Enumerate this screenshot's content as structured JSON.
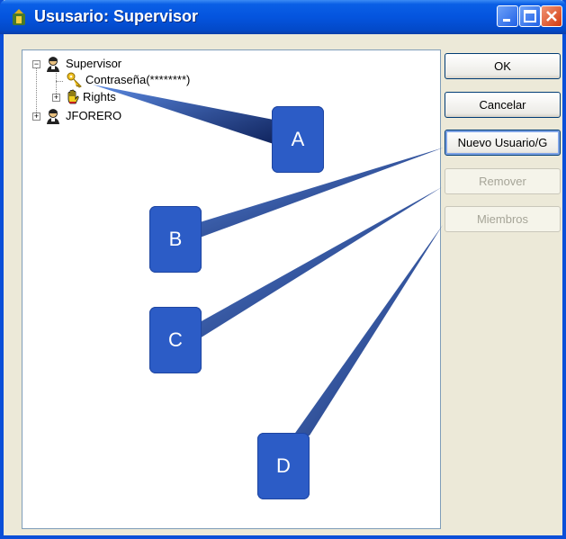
{
  "window": {
    "title": "Ususario: Supervisor",
    "controls": [
      "minimize",
      "maximize",
      "close"
    ]
  },
  "tree": {
    "nodes": [
      {
        "label": "Supervisor",
        "icon": "user-icon",
        "expanded": true
      },
      {
        "label": "Contraseña(********)",
        "icon": "key-icon"
      },
      {
        "label": "Rights",
        "icon": "hand-icon",
        "expanded": false
      },
      {
        "label": "JFORERO",
        "icon": "user-icon",
        "expanded": false
      }
    ]
  },
  "buttons": {
    "ok": "OK",
    "cancel": "Cancelar",
    "new_user": "Nuevo Usuario/G",
    "remove": "Remover",
    "members": "Miembros"
  },
  "callouts": [
    "A",
    "B",
    "C",
    "D"
  ],
  "colors": {
    "titlebar": "#0454de",
    "callout": "#2c5cc6",
    "face": "#ece9d8"
  }
}
